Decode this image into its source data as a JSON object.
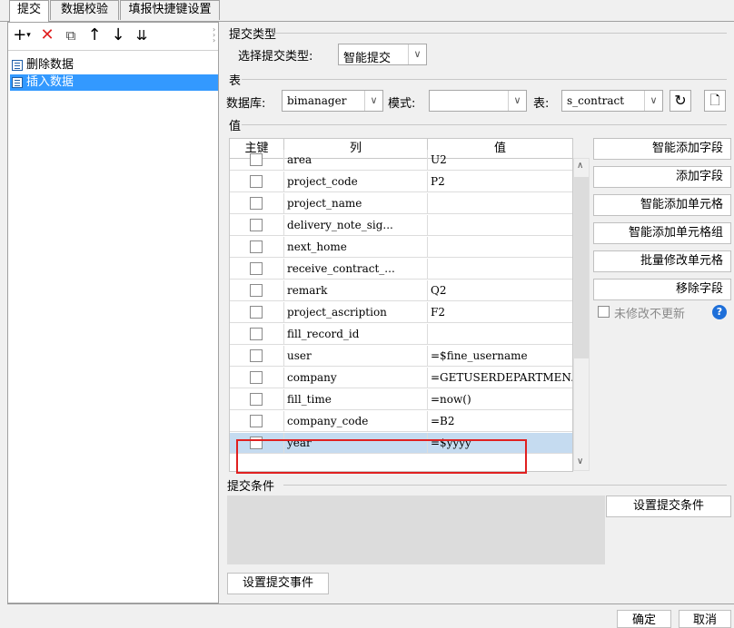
{
  "tabs": [
    "提交",
    "数据校验",
    "填报快捷键设置"
  ],
  "left": {
    "items": [
      {
        "label": "删除数据",
        "selected": false
      },
      {
        "label": "插入数据",
        "selected": true
      }
    ]
  },
  "submit_type": {
    "section": "提交类型",
    "label": "选择提交类型:",
    "value": "智能提交"
  },
  "table_section": {
    "section": "表",
    "db_label": "数据库:",
    "db_value": "bimanager",
    "mode_label": "模式:",
    "mode_value": "",
    "table_label": "表:",
    "table_value": "s_contract"
  },
  "values": {
    "section": "值",
    "headers": [
      "主键",
      "列",
      "值"
    ],
    "rows": [
      {
        "col": "area",
        "val": "U2"
      },
      {
        "col": "project_code",
        "val": "P2"
      },
      {
        "col": "project_name",
        "val": ""
      },
      {
        "col": "delivery_note_sig...",
        "val": ""
      },
      {
        "col": "next_home",
        "val": ""
      },
      {
        "col": "receive_contract_...",
        "val": ""
      },
      {
        "col": "remark",
        "val": "Q2"
      },
      {
        "col": "project_ascription",
        "val": "F2"
      },
      {
        "col": "fill_record_id",
        "val": ""
      },
      {
        "col": "user",
        "val": "=$fine_username"
      },
      {
        "col": "company",
        "val": "=GETUSERDEPARTMEN..."
      },
      {
        "col": "fill_time",
        "val": "=now()"
      },
      {
        "col": "company_code",
        "val": "=B2"
      },
      {
        "col": "year",
        "val": "=$yyyy"
      }
    ]
  },
  "side_buttons": [
    "智能添加字段",
    "添加字段",
    "智能添加单元格",
    "智能添加单元格组",
    "批量修改单元格",
    "移除字段"
  ],
  "no_update_label": "未修改不更新",
  "condition": {
    "section": "提交条件",
    "button": "设置提交条件"
  },
  "event_button": "设置提交事件",
  "footer": {
    "ok": "确定",
    "cancel": "取消"
  }
}
